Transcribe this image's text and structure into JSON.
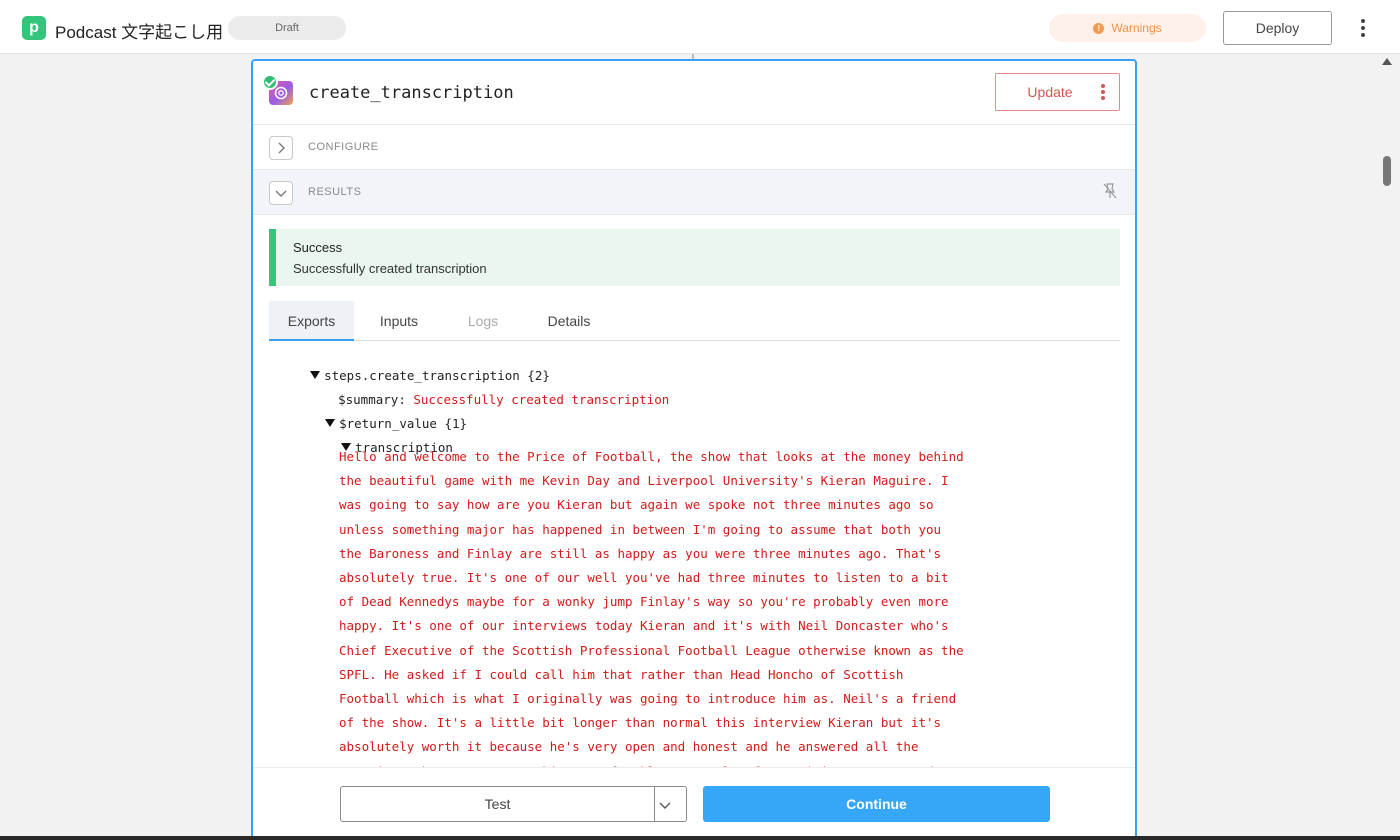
{
  "header": {
    "logo_letter": "p",
    "app_title": "Podcast 文字起こし用",
    "draft_label": "Draft",
    "warnings_label": "Warnings",
    "warnings_icon_glyph": "!",
    "deploy_label": "Deploy"
  },
  "step": {
    "name": "create_transcription",
    "update_label": "Update",
    "configure_label": "CONFIGURE",
    "results_label": "RESULTS"
  },
  "alert": {
    "title": "Success",
    "message": "Successfully created transcription"
  },
  "tabs": [
    "Exports",
    "Inputs",
    "Logs",
    "Details"
  ],
  "exports": {
    "root": "steps.create_transcription {2}",
    "summary_key": "$summary: ",
    "summary_value": "Successfully created transcription",
    "return_key": "$return_value {1}",
    "transcription_key": "transcription",
    "transcription_lines": [
      "Hello and welcome to the Price of Football, the show that looks at the money behind",
      "the beautiful game with me Kevin Day and Liverpool University's Kieran Maguire. I",
      "was going to say how are you Kieran but again we spoke not three minutes ago so",
      "unless something major has happened in between I'm going to assume that both you",
      "the Baroness and Finlay are still as happy as you were three minutes ago. That's",
      "absolutely true. It's one of our well you've had three minutes to listen to a bit",
      "of Dead Kennedys maybe for a wonky jump Finlay's way so you're probably even more",
      "happy. It's one of our interviews today Kieran and it's with Neil Doncaster who's",
      "Chief Executive of the Scottish Professional Football League otherwise known as the",
      "SPFL. He asked if I could call him that rather than Head Honcho of Scottish",
      "Football which is what I originally was going to introduce him as. Neil's a friend",
      "of the show. It's a little bit longer than normal this interview Kieran but it's",
      "absolutely worth it because he's very open and honest and he answered all the",
      "questions that were put to him very frankly. A couple of surprising answers and"
    ]
  },
  "footer": {
    "test_label": "Test",
    "continue_label": "Continue"
  },
  "colors": {
    "accent": "#3aa0f2",
    "success": "#34c77b",
    "export_value": "#d11a1a",
    "warning": "#f0904a"
  }
}
